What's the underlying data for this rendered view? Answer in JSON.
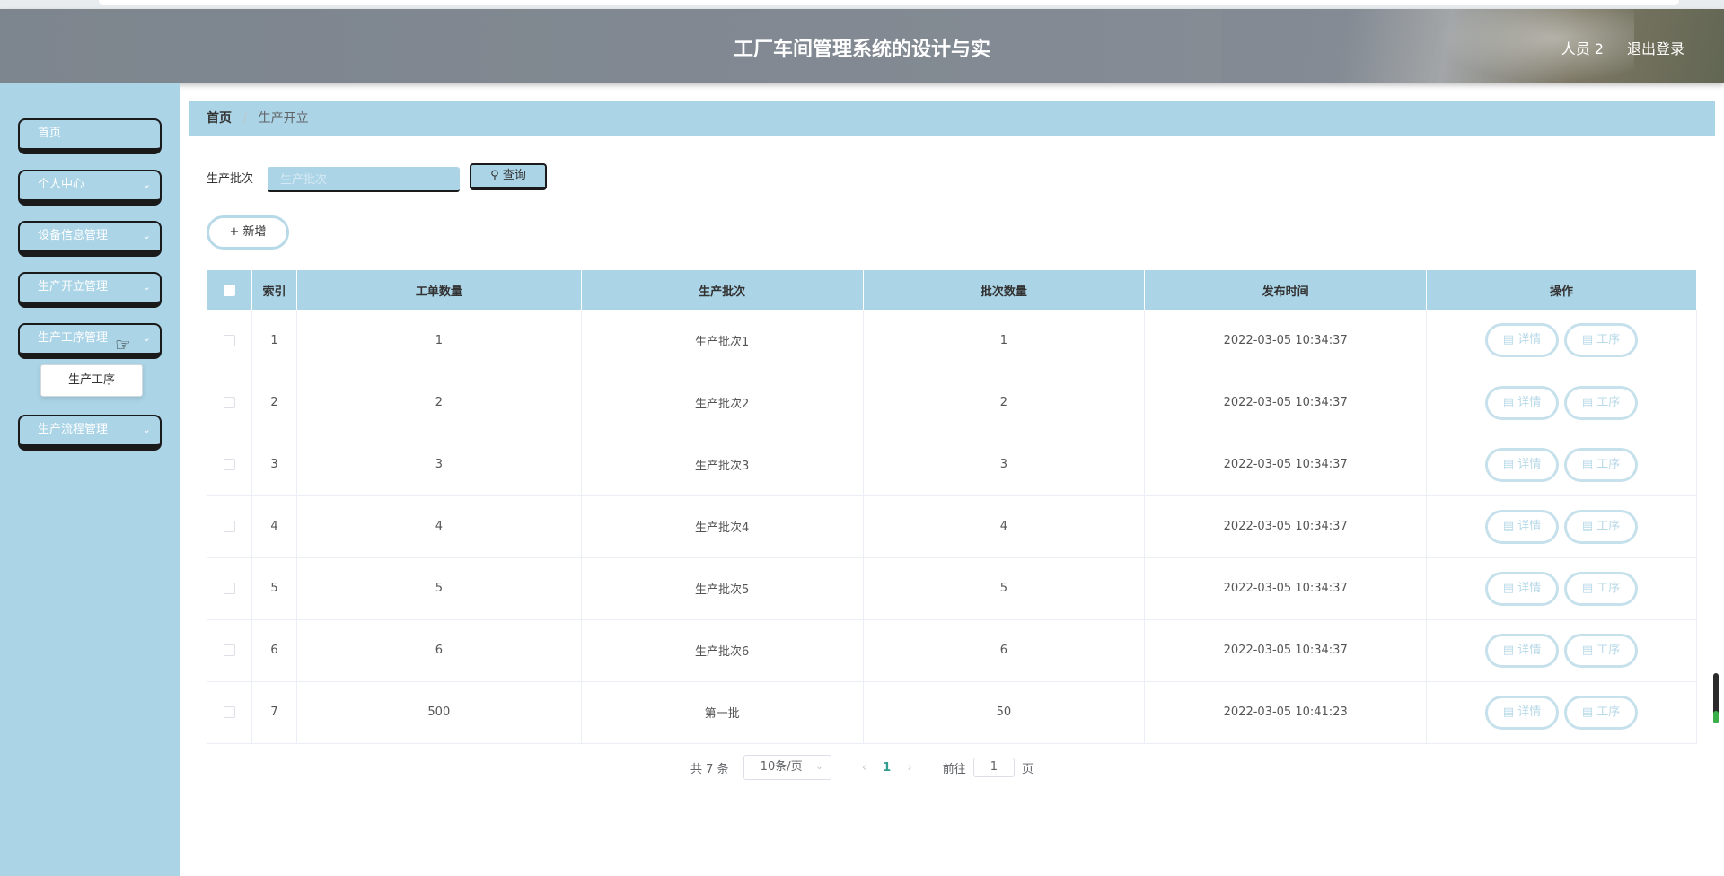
{
  "header": {
    "title": "工厂车间管理系统的设计与实",
    "user_label": "人员 2",
    "logout_label": "退出登录"
  },
  "sidebar": {
    "items": [
      {
        "label": "首页",
        "has_arrow": false
      },
      {
        "label": "个人中心",
        "has_arrow": true
      },
      {
        "label": "设备信息管理",
        "has_arrow": true
      },
      {
        "label": "生产开立管理",
        "has_arrow": true
      },
      {
        "label": "生产工序管理",
        "has_arrow": true
      },
      {
        "label": "生产流程管理",
        "has_arrow": true
      }
    ],
    "submenu_label": "生产工序"
  },
  "breadcrumb": {
    "home": "首页",
    "separator": "/",
    "current": "生产开立"
  },
  "search": {
    "label": "生产批次",
    "placeholder": "生产批次",
    "button_label": "查询"
  },
  "toolbar": {
    "add_label": "新增"
  },
  "table": {
    "headers": [
      "索引",
      "工单数量",
      "生产批次",
      "批次数量",
      "发布时间",
      "操作"
    ],
    "rows": [
      {
        "index": "1",
        "qty": "1",
        "batch": "生产批次1",
        "batch_qty": "1",
        "time": "2022-03-05 10:34:37"
      },
      {
        "index": "2",
        "qty": "2",
        "batch": "生产批次2",
        "batch_qty": "2",
        "time": "2022-03-05 10:34:37"
      },
      {
        "index": "3",
        "qty": "3",
        "batch": "生产批次3",
        "batch_qty": "3",
        "time": "2022-03-05 10:34:37"
      },
      {
        "index": "4",
        "qty": "4",
        "batch": "生产批次4",
        "batch_qty": "4",
        "time": "2022-03-05 10:34:37"
      },
      {
        "index": "5",
        "qty": "5",
        "batch": "生产批次5",
        "batch_qty": "5",
        "time": "2022-03-05 10:34:37"
      },
      {
        "index": "6",
        "qty": "6",
        "batch": "生产批次6",
        "batch_qty": "6",
        "time": "2022-03-05 10:34:37"
      },
      {
        "index": "7",
        "qty": "500",
        "batch": "第一批",
        "batch_qty": "50",
        "time": "2022-03-05 10:41:23"
      }
    ],
    "detail_label": "详情",
    "process_label": "工序"
  },
  "pagination": {
    "total_label": "共 7 条",
    "page_size": "10条/页",
    "current_page": "1",
    "goto_prefix": "前往",
    "goto_value": "1",
    "goto_suffix": "页"
  }
}
